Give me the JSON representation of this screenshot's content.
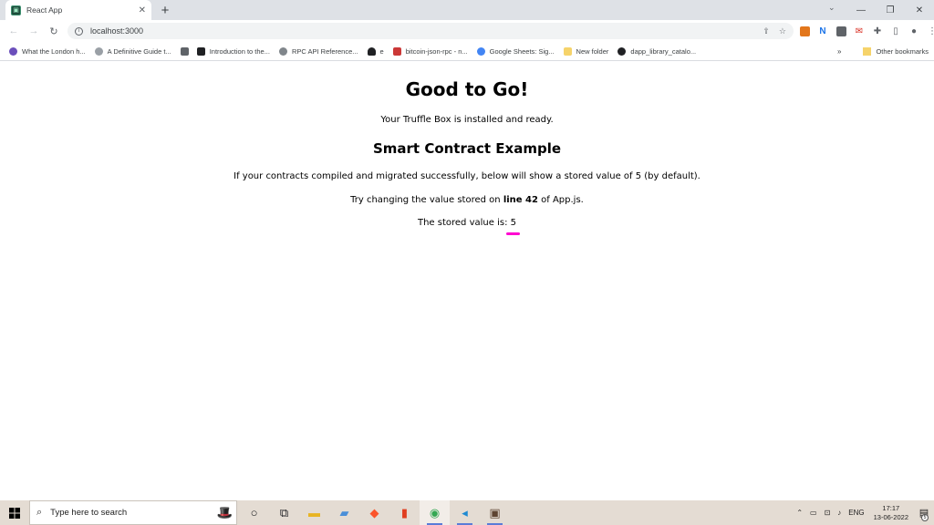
{
  "browser": {
    "tab_title": "React App",
    "url": "localhost:3000",
    "bookmarks": [
      {
        "label": "What the London h...",
        "color": "#6b4fbb"
      },
      {
        "label": "A Definitive Guide t...",
        "color": "#9aa0a6"
      },
      {
        "label": "Introduction to the...",
        "color": "#5f6368"
      },
      {
        "label": "Introduction to the...",
        "color": "#202124"
      },
      {
        "label": "RPC API Reference...",
        "color": "#80868b"
      },
      {
        "label": "e",
        "color": "#202124"
      },
      {
        "label": "bitcoin-json-rpc - n...",
        "color": "#cb3837"
      },
      {
        "label": "Google Sheets: Sig...",
        "color": "#4285f4"
      },
      {
        "label": "New folder",
        "color": "#f6d36a"
      },
      {
        "label": "dapp_library_catalo...",
        "color": "#202124"
      }
    ],
    "other_bookmarks": "Other bookmarks"
  },
  "page": {
    "title": "Good to Go!",
    "intro": "Your Truffle Box is installed and ready.",
    "subtitle": "Smart Contract Example",
    "description": "If your contracts compiled and migrated successfully, below will show a stored value of 5 (by default).",
    "try_prefix": "Try changing the value stored on ",
    "try_bold": "line 42",
    "try_suffix": " of App.js.",
    "stored_label": "The stored value is: ",
    "stored_value": "5"
  },
  "taskbar": {
    "search_placeholder": "Type here to search",
    "language": "ENG",
    "time": "17:17",
    "date": "13-06-2022",
    "notification_count": "5"
  }
}
